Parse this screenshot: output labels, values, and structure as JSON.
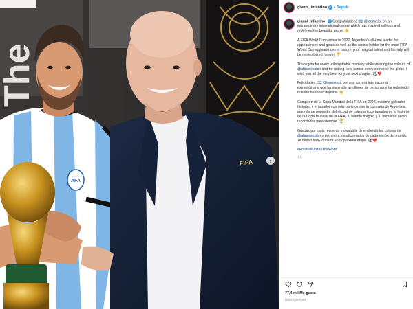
{
  "photo": {
    "wall_text": "The",
    "shirt_badge_text": "AFA",
    "suit_badge_text": "FIFA",
    "next_icon": "chevron-right-icon"
  },
  "header": {
    "username": "gianni_infantino",
    "follow_label": "Seguir",
    "separator": "•"
  },
  "caption": {
    "username": "gianni_infantino",
    "paragraphs": [
      {
        "pre": "Congratulations 🇦🇷 ",
        "mention": "@leomessi",
        "post": " on an extraordinary international career which has inspired millions and redefined the beautiful game. 👏"
      },
      {
        "pre": "A FIFA World Cup winner in 2022, Argentina’s all-time leader for appearances and goals as well as the record holder for the most FIFA World Cup appearances in history, your magical talent and humility will be remembered forever. 🏆",
        "mention": "",
        "post": ""
      },
      {
        "pre": "Thank you for every unforgettable memory while wearing the colours of ",
        "mention": "@afaseleccion",
        "post": " and for uniting fans across every corner of the globe. I wish you all the very best for your next chapter. ⚽❤️"
      },
      {
        "pre": "Felicidades, 🇦🇷 ",
        "mention": "@leomessi",
        "post": ", por una carrera internacional extraordinaria que ha inspirado a millones de personas y ha redefinido nuestro hermoso deporte. 👏"
      },
      {
        "pre": "Campeón de la Copa Mundial de la FIFA en 2022, máximo goleador histórico y el jugador con más partidos con la camiseta de Argentina, además de poseedor del récord de más partidos jugados en la historia de la Copa Mundial de la FIFA: tu talento mágico y tu humildad serán recordados para siempre. 🏆",
        "mention": "",
        "post": ""
      },
      {
        "pre": "Gracias por cada recuerdo inolvidable defendiendo los colores de ",
        "mention": "@afaseleccion",
        "post": " y por unir a los aficionados de cada rincón del mundo. Te deseo todo lo mejor en tu próxima etapa. ⚽❤️"
      }
    ],
    "hashtag": "#FootballUnitesTheWorld",
    "time": "1 h"
  },
  "actions": {
    "icons": [
      "heart-icon",
      "comment-icon",
      "share-icon",
      "bookmark-icon"
    ],
    "likes": "77,4 mil Me gusta",
    "ago": "Hace una hora"
  }
}
